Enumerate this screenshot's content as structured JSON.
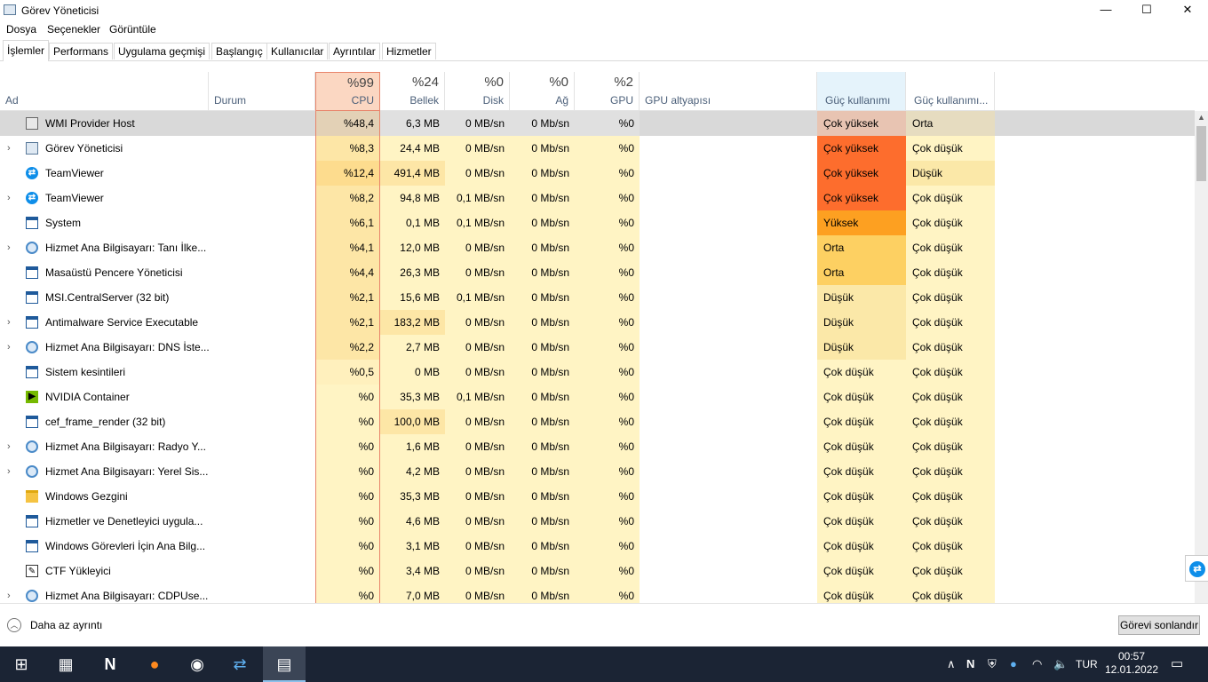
{
  "window": {
    "title": "Görev Yöneticisi",
    "minimize": "—",
    "maximize": "☐",
    "close": "✕"
  },
  "menu": [
    "Dosya",
    "Seçenekler",
    "Görüntüle"
  ],
  "tabs": [
    "İşlemler",
    "Performans",
    "Uygulama geçmişi",
    "Başlangıç",
    "Kullanıcılar",
    "Ayrıntılar",
    "Hizmetler"
  ],
  "columns": {
    "name": "Ad",
    "status": "Durum",
    "cpu": {
      "pct": "%99",
      "label": "CPU"
    },
    "memory": {
      "pct": "%24",
      "label": "Bellek"
    },
    "disk": {
      "pct": "%0",
      "label": "Disk"
    },
    "network": {
      "pct": "%0",
      "label": "Ağ"
    },
    "gpu": {
      "pct": "%2",
      "label": "GPU"
    },
    "gpu_engine": "GPU altyapısı",
    "power": "Güç kullanımı",
    "power_trend": "Güç kullanımı..."
  },
  "colors": {
    "cpu_header": "#fbd7c2",
    "cell_light": "#fff4c4",
    "selected_row": "#d9d9d9",
    "power_very_high": "#fd6d2d",
    "power_high": "#fda021",
    "power_medium": "#fdd062",
    "power_low": "#fbe8a8",
    "power_very_low": "#fff4c4"
  },
  "processes": [
    {
      "name": "WMI Provider Host",
      "icon": "wmi-icon",
      "expand": false,
      "cpu": "%48,4",
      "memory": "6,3 MB",
      "disk": "0 MB/sn",
      "network": "0 Mb/sn",
      "gpu": "%0",
      "power": "Çok yüksek",
      "power_trend": "Orta"
    },
    {
      "name": "Görev Yöneticisi",
      "icon": "task-manager-icon",
      "expand": true,
      "cpu": "%8,3",
      "memory": "24,4 MB",
      "disk": "0 MB/sn",
      "network": "0 Mb/sn",
      "gpu": "%0",
      "power": "Çok yüksek",
      "power_trend": "Çok düşük"
    },
    {
      "name": "TeamViewer",
      "icon": "teamviewer-icon",
      "expand": false,
      "cpu": "%12,4",
      "memory": "491,4 MB",
      "disk": "0 MB/sn",
      "network": "0 Mb/sn",
      "gpu": "%0",
      "power": "Çok yüksek",
      "power_trend": "Düşük"
    },
    {
      "name": "TeamViewer",
      "icon": "teamviewer-icon",
      "expand": true,
      "cpu": "%8,2",
      "memory": "94,8 MB",
      "disk": "0,1 MB/sn",
      "network": "0 Mb/sn",
      "gpu": "%0",
      "power": "Çok yüksek",
      "power_trend": "Çok düşük"
    },
    {
      "name": "System",
      "icon": "window-icon",
      "expand": false,
      "cpu": "%6,1",
      "memory": "0,1 MB",
      "disk": "0,1 MB/sn",
      "network": "0 Mb/sn",
      "gpu": "%0",
      "power": "Yüksek",
      "power_trend": "Çok düşük"
    },
    {
      "name": "Hizmet Ana Bilgisayarı: Tanı İlke...",
      "icon": "gear-icon",
      "expand": true,
      "cpu": "%4,1",
      "memory": "12,0 MB",
      "disk": "0 MB/sn",
      "network": "0 Mb/sn",
      "gpu": "%0",
      "power": "Orta",
      "power_trend": "Çok düşük"
    },
    {
      "name": "Masaüstü Pencere Yöneticisi",
      "icon": "window-icon",
      "expand": false,
      "cpu": "%4,4",
      "memory": "26,3 MB",
      "disk": "0 MB/sn",
      "network": "0 Mb/sn",
      "gpu": "%0",
      "power": "Orta",
      "power_trend": "Çok düşük"
    },
    {
      "name": "MSI.CentralServer (32 bit)",
      "icon": "window-icon",
      "expand": false,
      "cpu": "%2,1",
      "memory": "15,6 MB",
      "disk": "0,1 MB/sn",
      "network": "0 Mb/sn",
      "gpu": "%0",
      "power": "Düşük",
      "power_trend": "Çok düşük"
    },
    {
      "name": "Antimalware Service Executable",
      "icon": "window-icon",
      "expand": true,
      "cpu": "%2,1",
      "memory": "183,2 MB",
      "disk": "0 MB/sn",
      "network": "0 Mb/sn",
      "gpu": "%0",
      "power": "Düşük",
      "power_trend": "Çok düşük"
    },
    {
      "name": "Hizmet Ana Bilgisayarı: DNS İste...",
      "icon": "gear-icon",
      "expand": true,
      "cpu": "%2,2",
      "memory": "2,7 MB",
      "disk": "0 MB/sn",
      "network": "0 Mb/sn",
      "gpu": "%0",
      "power": "Düşük",
      "power_trend": "Çok düşük"
    },
    {
      "name": "Sistem kesintileri",
      "icon": "window-icon",
      "expand": false,
      "cpu": "%0,5",
      "memory": "0 MB",
      "disk": "0 MB/sn",
      "network": "0 Mb/sn",
      "gpu": "%0",
      "power": "Çok düşük",
      "power_trend": "Çok düşük"
    },
    {
      "name": "NVIDIA Container",
      "icon": "nvidia-icon",
      "expand": false,
      "cpu": "%0",
      "memory": "35,3 MB",
      "disk": "0,1 MB/sn",
      "network": "0 Mb/sn",
      "gpu": "%0",
      "power": "Çok düşük",
      "power_trend": "Çok düşük"
    },
    {
      "name": "cef_frame_render (32 bit)",
      "icon": "window-icon",
      "expand": false,
      "cpu": "%0",
      "memory": "100,0 MB",
      "disk": "0 MB/sn",
      "network": "0 Mb/sn",
      "gpu": "%0",
      "power": "Çok düşük",
      "power_trend": "Çok düşük"
    },
    {
      "name": "Hizmet Ana Bilgisayarı: Radyo Y...",
      "icon": "gear-icon",
      "expand": true,
      "cpu": "%0",
      "memory": "1,6 MB",
      "disk": "0 MB/sn",
      "network": "0 Mb/sn",
      "gpu": "%0",
      "power": "Çok düşük",
      "power_trend": "Çok düşük"
    },
    {
      "name": "Hizmet Ana Bilgisayarı: Yerel Sis...",
      "icon": "gear-icon",
      "expand": true,
      "cpu": "%0",
      "memory": "4,2 MB",
      "disk": "0 MB/sn",
      "network": "0 Mb/sn",
      "gpu": "%0",
      "power": "Çok düşük",
      "power_trend": "Çok düşük"
    },
    {
      "name": "Windows Gezgini",
      "icon": "folder-icon",
      "expand": false,
      "cpu": "%0",
      "memory": "35,3 MB",
      "disk": "0 MB/sn",
      "network": "0 Mb/sn",
      "gpu": "%0",
      "power": "Çok düşük",
      "power_trend": "Çok düşük"
    },
    {
      "name": "Hizmetler ve Denetleyici uygula...",
      "icon": "window-icon",
      "expand": false,
      "cpu": "%0",
      "memory": "4,6 MB",
      "disk": "0 MB/sn",
      "network": "0 Mb/sn",
      "gpu": "%0",
      "power": "Çok düşük",
      "power_trend": "Çok düşük"
    },
    {
      "name": "Windows Görevleri İçin Ana Bilg...",
      "icon": "window-icon",
      "expand": false,
      "cpu": "%0",
      "memory": "3,1 MB",
      "disk": "0 MB/sn",
      "network": "0 Mb/sn",
      "gpu": "%0",
      "power": "Çok düşük",
      "power_trend": "Çok düşük"
    },
    {
      "name": "CTF Yükleyici",
      "icon": "pen-icon",
      "expand": false,
      "cpu": "%0",
      "memory": "3,4 MB",
      "disk": "0 MB/sn",
      "network": "0 Mb/sn",
      "gpu": "%0",
      "power": "Çok düşük",
      "power_trend": "Çok düşük"
    },
    {
      "name": "Hizmet Ana Bilgisayarı: CDPUse...",
      "icon": "gear-icon",
      "expand": true,
      "cpu": "%0",
      "memory": "7,0 MB",
      "disk": "0 MB/sn",
      "network": "0 Mb/sn",
      "gpu": "%0",
      "power": "Çok düşük",
      "power_trend": "Çok düşük"
    }
  ],
  "footer": {
    "fewer_details": "Daha az ayrıntı",
    "end_task": "Görevi sonlandır"
  },
  "taskbar": {
    "icons": [
      "windows-start-icon",
      "calculator-icon",
      "notion-icon",
      "firefox-icon",
      "obs-icon",
      "teamviewer-icon",
      "task-manager-icon"
    ],
    "language": "TUR",
    "time": "00:57",
    "date": "12.01.2022"
  }
}
